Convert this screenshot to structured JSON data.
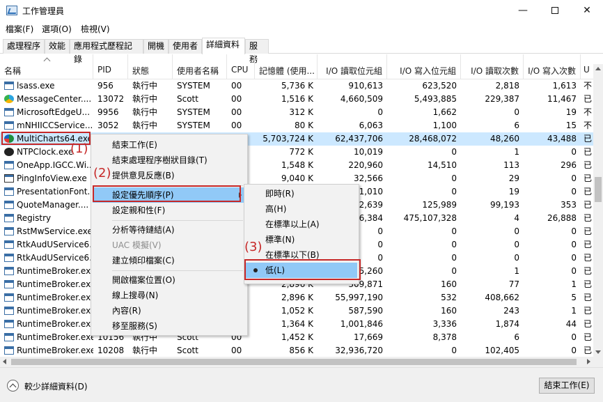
{
  "window": {
    "title": "工作管理員",
    "minimize": "—",
    "close": "✕"
  },
  "menubar": [
    "檔案(F)",
    "選項(O)",
    "檢視(V)"
  ],
  "tabs": [
    "處理程序",
    "效能",
    "應用程式歷程記錄",
    "開機",
    "使用者",
    "詳細資料",
    "服務"
  ],
  "active_tab": 5,
  "columns": [
    "名稱",
    "PID",
    "狀態",
    "使用者名稱",
    "CPU",
    "記憶體 (使用...",
    "I/O 讀取位元組",
    "I/O 寫入位元組",
    "I/O 讀取次數",
    "I/O 寫入次數",
    "U"
  ],
  "rows": [
    {
      "icon": "window",
      "cells": [
        "lsass.exe",
        "956",
        "執行中",
        "SYSTEM",
        "00",
        "5,736 K",
        "910,613",
        "623,520",
        "2,818",
        "1,613",
        "不"
      ]
    },
    {
      "icon": "message-center",
      "cells": [
        "MessageCenter....",
        "13072",
        "執行中",
        "Scott",
        "00",
        "1,516 K",
        "4,660,509",
        "5,493,885",
        "229,387",
        "11,467",
        "已"
      ]
    },
    {
      "icon": "window",
      "cells": [
        "MicrosoftEdgeU...",
        "9956",
        "執行中",
        "SYSTEM",
        "00",
        "312 K",
        "0",
        "1,662",
        "0",
        "19",
        "不"
      ]
    },
    {
      "icon": "window",
      "cells": [
        "mNHIICCService....",
        "3052",
        "執行中",
        "SYSTEM",
        "00",
        "80 K",
        "6,063",
        "1,100",
        "6",
        "15",
        "不"
      ]
    },
    {
      "icon": "multicharts",
      "cells": [
        "MultiCharts64.exe",
        "",
        "",
        "",
        "",
        "5,703,724 K",
        "62,437,706",
        "28,468,072",
        "48,260",
        "43,488",
        "已"
      ]
    },
    {
      "icon": "clock",
      "cells": [
        "NTPClock.exe",
        "",
        "",
        "",
        "",
        "772 K",
        "10,019",
        "0",
        "1",
        "0",
        "已"
      ]
    },
    {
      "icon": "window",
      "cells": [
        "OneApp.IGCC.Wi...",
        "",
        "",
        "",
        "",
        "1,548 K",
        "220,960",
        "14,510",
        "113",
        "296",
        "已"
      ]
    },
    {
      "icon": "pin",
      "cells": [
        "PingInfoView.exe",
        "",
        "",
        "",
        "",
        "9,040 K",
        "32,566",
        "0",
        "29",
        "0",
        "已"
      ]
    },
    {
      "icon": "window",
      "cells": [
        "PresentationFont...",
        "",
        "",
        "",
        "",
        "",
        "11,010",
        "0",
        "19",
        "0",
        "已"
      ]
    },
    {
      "icon": "doc",
      "cells": [
        "QuoteManager....",
        "",
        "",
        "",
        "",
        "",
        "52,639",
        "125,989",
        "99,193",
        "353",
        "已"
      ]
    },
    {
      "icon": "window",
      "cells": [
        "Registry",
        "",
        "",
        "",
        "",
        "",
        "6,384",
        "475,107,328",
        "4",
        "26,888",
        "已"
      ]
    },
    {
      "icon": "window",
      "cells": [
        "RstMwService.exe",
        "",
        "",
        "",
        "",
        "",
        "0",
        "0",
        "0",
        "0",
        "已"
      ]
    },
    {
      "icon": "window",
      "cells": [
        "RtkAudUService6...",
        "",
        "",
        "",
        "",
        "",
        "0",
        "0",
        "0",
        "0",
        "已"
      ]
    },
    {
      "icon": "window",
      "cells": [
        "RtkAudUService6...",
        "",
        "",
        "",
        "",
        "",
        "0",
        "0",
        "0",
        "0",
        "已"
      ]
    },
    {
      "icon": "window",
      "cells": [
        "RuntimeBroker.exe",
        "",
        "",
        "",
        "",
        "",
        "5,260",
        "0",
        "1",
        "0",
        "已"
      ]
    },
    {
      "icon": "window",
      "cells": [
        "RuntimeBroker.exe",
        "",
        "",
        "",
        "",
        "2,896 K",
        "309,871",
        "160",
        "77",
        "1",
        "已"
      ]
    },
    {
      "icon": "window",
      "cells": [
        "RuntimeBroker.exe",
        "",
        "",
        "",
        "",
        "2,896 K",
        "55,997,190",
        "532",
        "408,662",
        "5",
        "已"
      ]
    },
    {
      "icon": "window",
      "cells": [
        "RuntimeBroker.exe",
        "",
        "",
        "",
        "",
        "1,052 K",
        "587,590",
        "160",
        "243",
        "1",
        "已"
      ]
    },
    {
      "icon": "window",
      "cells": [
        "RuntimeBroker.exe",
        "",
        "",
        "",
        "",
        "1,364 K",
        "1,001,846",
        "3,336",
        "1,874",
        "44",
        "已"
      ]
    },
    {
      "icon": "window",
      "cells": [
        "RuntimeBroker.exe",
        "10156",
        "執行中",
        "Scott",
        "00",
        "1,452 K",
        "17,669",
        "8,378",
        "6",
        "0",
        "已"
      ]
    },
    {
      "icon": "window",
      "cells": [
        "RuntimeBroker.exe",
        "10208",
        "執行中",
        "Scott",
        "00",
        "856 K",
        "32,936,720",
        "0",
        "102,405",
        "0",
        "已"
      ]
    }
  ],
  "context_menu": {
    "items": [
      "結束工作(E)",
      "結束處理程序樹狀目錄(T)",
      "提供意見反應(B)",
      "設定優先順序(P)",
      "設定親和性(F)",
      "分析等待鏈結(A)",
      "UAC 模擬(V)",
      "建立傾印檔案(C)",
      "開啟檔案位置(O)",
      "線上搜尋(N)",
      "內容(R)",
      "移至服務(S)"
    ]
  },
  "priority_menu": {
    "items": [
      "即時(R)",
      "高(H)",
      "在標準以上(A)",
      "標準(N)",
      "在標準以下(B)",
      "低(L)"
    ],
    "selected": 5
  },
  "annotations": [
    "(1)",
    "(2)",
    "(3)"
  ],
  "annotation_color": "#c62828",
  "selection_color": "#cce8ff",
  "footer": {
    "fewer_details": "較少詳細資料(D)",
    "end_task": "結束工作(E)"
  }
}
